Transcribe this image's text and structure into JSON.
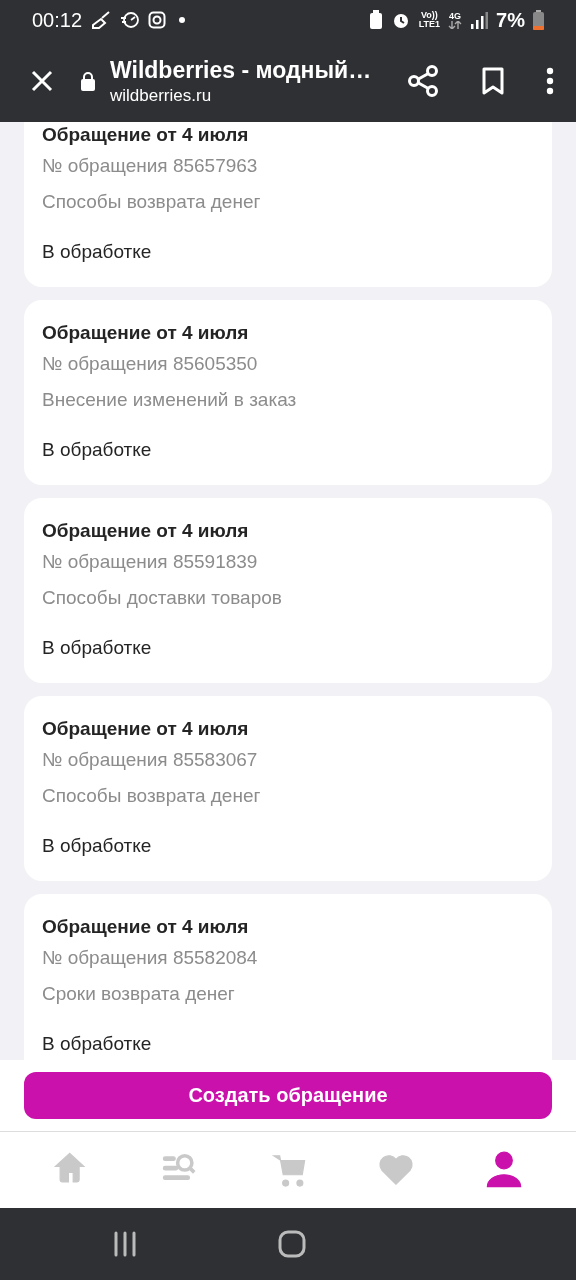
{
  "status_bar": {
    "time": "00:12",
    "volte": "Vo))",
    "lte": "LTE1",
    "network": "4G",
    "battery": "7%"
  },
  "browser_bar": {
    "title": "Wildberries - модный…",
    "url": "wildberries.ru"
  },
  "requests": [
    {
      "title": "Обращение от 4 июля",
      "number": "№ обращения 85657963",
      "topic": "Способы возврата денег",
      "status": "В обработке"
    },
    {
      "title": "Обращение от 4 июля",
      "number": "№ обращения 85605350",
      "topic": "Внесение изменений в заказ",
      "status": "В обработке"
    },
    {
      "title": "Обращение от 4 июля",
      "number": "№ обращения 85591839",
      "topic": "Способы доставки товаров",
      "status": "В обработке"
    },
    {
      "title": "Обращение от 4 июля",
      "number": "№ обращения 85583067",
      "topic": "Способы возврата денег",
      "status": "В обработке"
    },
    {
      "title": "Обращение от 4 июля",
      "number": "№ обращения 85582084",
      "topic": "Сроки возврата денег",
      "status": "В обработке"
    }
  ],
  "create_button": "Создать обращение",
  "bottom_nav": [
    {
      "kind": "home",
      "selected": false
    },
    {
      "kind": "catalog",
      "selected": false
    },
    {
      "kind": "cart",
      "selected": false
    },
    {
      "kind": "favorites",
      "selected": false
    },
    {
      "kind": "profile",
      "selected": true
    }
  ]
}
